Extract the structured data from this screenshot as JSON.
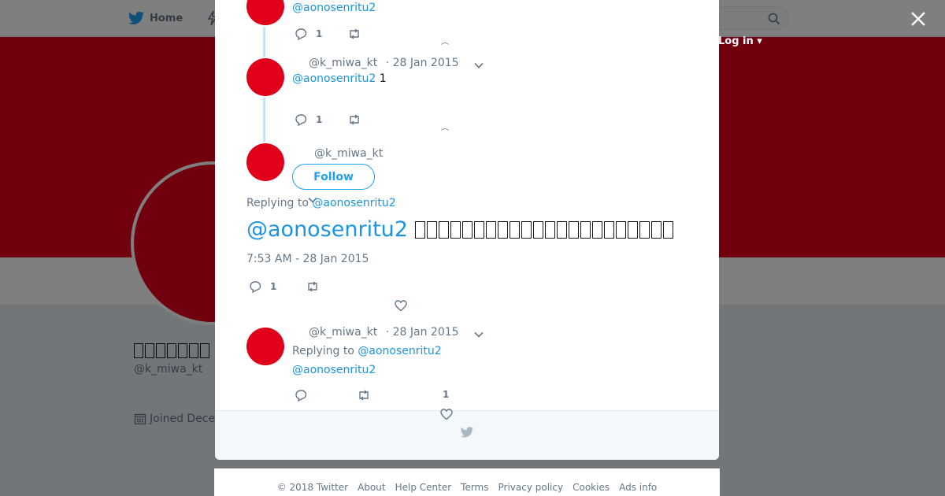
{
  "topbar": {
    "home_label": "Home",
    "login_label": "Log in"
  },
  "profile": {
    "name_placeholder_glyph_count": 7,
    "handle": "@k_miwa_kt",
    "joined": "Joined Dece"
  },
  "colors": {
    "brand": "#1da1f2",
    "link": "#1b95e0",
    "banner": "#e0001a"
  },
  "tweets": [
    {
      "reply_to": "@aonosenritu2",
      "reply_count": "1"
    },
    {
      "handle": "@k_miwa_kt",
      "date": "· 28 Jan 2015",
      "reply_to": "@aonosenritu2",
      "text": "1",
      "reply_count": "1"
    }
  ],
  "main_tweet": {
    "handle": "@k_miwa_kt",
    "follow_label": "Follow",
    "replying_prefix": "Replying to",
    "replying_to": "@aonosenritu2",
    "mention": "@aonosenritu2",
    "body_glyph_count": 22,
    "timestamp": "7:53 AM - 28 Jan 2015",
    "reply_count": "1"
  },
  "reply_tweet": {
    "handle": "@k_miwa_kt",
    "date": "· 28 Jan 2015",
    "replying_prefix": "Replying to",
    "replying_to": "@aonosenritu2",
    "mention": "@aonosenritu2",
    "like_count": "1"
  },
  "footer": {
    "links": [
      "© 2018 Twitter",
      "About",
      "Help Center",
      "Terms",
      "Privacy policy",
      "Cookies",
      "Ads info"
    ]
  },
  "icons": [
    "twitter-bird-icon",
    "lightning-icon",
    "search-icon",
    "close-icon",
    "reply-icon",
    "retweet-icon",
    "like-icon",
    "chevron-down-icon",
    "calendar-icon"
  ]
}
